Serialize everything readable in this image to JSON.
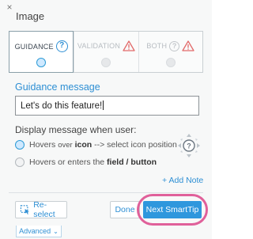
{
  "header": {
    "title": "Image",
    "close_glyph": "×"
  },
  "modes": [
    {
      "label": "GUIDANCE",
      "icon": "question-icon",
      "active": true
    },
    {
      "label": "VALIDATION",
      "icon": "warning-icon",
      "active": false
    },
    {
      "label": "BOTH",
      "icon": "question-warning-icon",
      "active": false
    }
  ],
  "guidance": {
    "heading": "Guidance message",
    "message_value": "Let's do this feature!"
  },
  "display": {
    "label": "Display message when user:",
    "option1_prefix": "Hovers ",
    "option1_small": "over",
    "option1_bold": " icon",
    "option1_suffix": " --> select icon position",
    "option2_prefix": "Hovers or enters the ",
    "option2_bold": "field / button"
  },
  "add_note": "+ Add Note",
  "footer": {
    "reselect_label": "Re-select",
    "done_label": "Done",
    "next_label": "Next SmartTip",
    "advanced_label": "Advanced"
  },
  "colors": {
    "accent": "#2e97dd",
    "highlight": "#e0609a",
    "warning": "#e26a6a"
  }
}
